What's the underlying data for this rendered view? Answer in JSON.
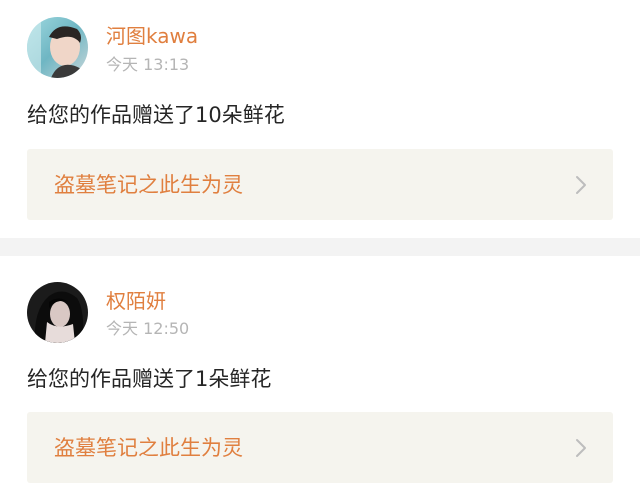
{
  "notifications": [
    {
      "username": "河图kawa",
      "timestamp": "今天 13:13",
      "message": "给您的作品赠送了10朵鲜花",
      "work_title": "盗墓笔记之此生为灵",
      "avatar_icon": "user-avatar-photo"
    },
    {
      "username": "权陌妍",
      "timestamp": "今天 12:50",
      "message": "给您的作品赠送了1朵鲜花",
      "work_title": "盗墓笔记之此生为灵",
      "avatar_icon": "user-avatar-photo"
    }
  ],
  "colors": {
    "accent": "#e07f3f",
    "text": "#262626",
    "muted": "#b5b5b5",
    "link_bg": "#f5f4ee",
    "divider": "#f3f3f3"
  },
  "icons": {
    "chevron": "chevron-right-icon"
  }
}
